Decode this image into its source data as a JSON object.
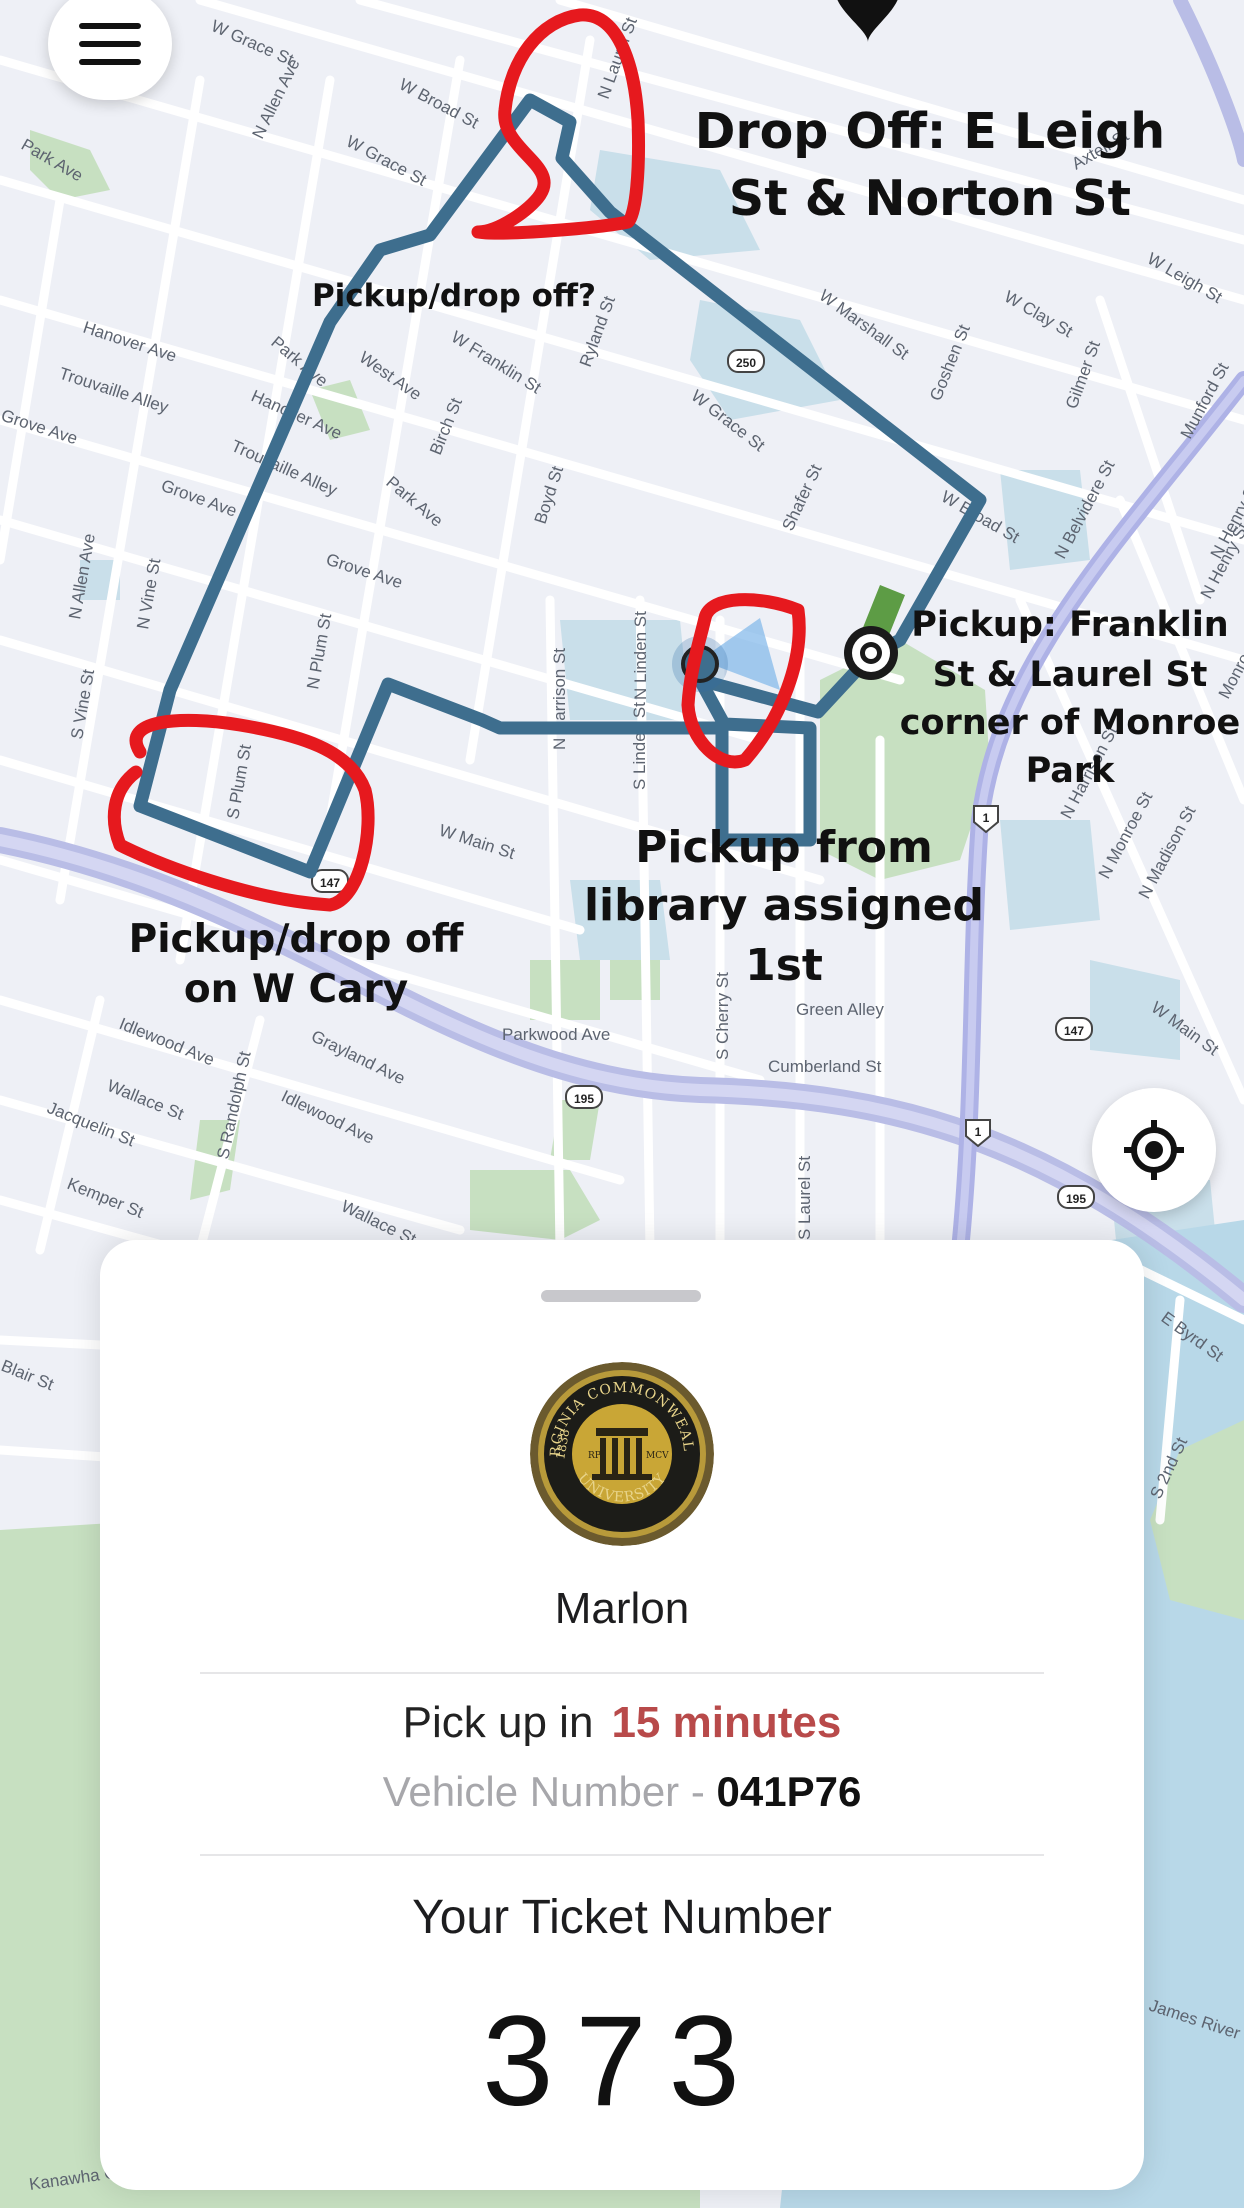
{
  "map": {
    "streets": [
      "W Grace St",
      "N Allen Ave",
      "W Broad St",
      "W Grace St",
      "Park Ave",
      "Hanover Ave",
      "Trouvaille Alley",
      "Grove Ave",
      "Park Ave",
      "West Ave",
      "W Franklin St",
      "Ryland St",
      "N Laurel St",
      "Hanover Ave",
      "Trouvaille Alley",
      "Grove Ave",
      "Park Ave",
      "Birch St",
      "Boyd St",
      "W Marshall St",
      "W Clay St",
      "W Grace St",
      "Shafer St",
      "W Broad St",
      "Goshen St",
      "Gilmer St",
      "W Leigh St",
      "N Allen Ave",
      "N Vine St",
      "S Vine St",
      "N Plum St",
      "S Plum St",
      "Grove Ave",
      "N Harrison St",
      "N Linden St",
      "S Linden St",
      "W Main St",
      "Parkwood Ave",
      "Green Alley",
      "Cumberland St",
      "Idlewood Ave",
      "Wallace St",
      "Jacquelin St",
      "Kemper St",
      "Idlewood Ave",
      "Grayland Ave",
      "S Randolph St",
      "Wallace St",
      "S Laurel St",
      "N Belvidere St",
      "N Henry St",
      "N Harrison St",
      "N Monroe St",
      "N Madison St",
      "W Main St",
      "E Byrd St",
      "S 2nd St",
      "James River",
      "Kanawha Canal",
      "Blair St",
      "N Henry St",
      "Monroe St",
      "Munford St",
      "Axtell St",
      "S Cherry St"
    ],
    "route_shields": [
      "250",
      "147",
      "195",
      "1",
      "147",
      "195",
      "1"
    ],
    "annotations": {
      "dropoff": [
        "Drop Off: E Leigh",
        "St & Norton St"
      ],
      "pickup_dropoff_q": "Pickup/drop off?",
      "franklin": [
        "Pickup: Franklin",
        "St & Laurel St",
        "corner of Monroe",
        "Park"
      ],
      "library": [
        "Pickup from",
        "library assigned",
        "1st"
      ],
      "cary": [
        "Pickup/drop off",
        "on W Cary"
      ]
    }
  },
  "buttons": {
    "menu_icon": "hamburger-icon",
    "locate_icon": "crosshair-icon"
  },
  "colors": {
    "route": "#3e6e8e",
    "annotation_red": "#e6191e",
    "minutes_red": "#b84a4a",
    "sheet_bg": "#ffffff",
    "map_bg": "#eef0f6"
  },
  "sheet": {
    "driver_name": "Marlon",
    "logo": {
      "top_text": "VIRGINIA COMMONWEALTH",
      "bottom_text": "UNIVERSITY",
      "left_text": "1838",
      "rpi_text": "RPI",
      "mcv_text": "MCV"
    },
    "pickup_prefix": "Pick up in",
    "pickup_minutes": "15 minutes",
    "vehicle_prefix": "Vehicle Number -",
    "vehicle_number": "041P76",
    "ticket_label": "Your Ticket Number",
    "ticket_number": "373"
  }
}
